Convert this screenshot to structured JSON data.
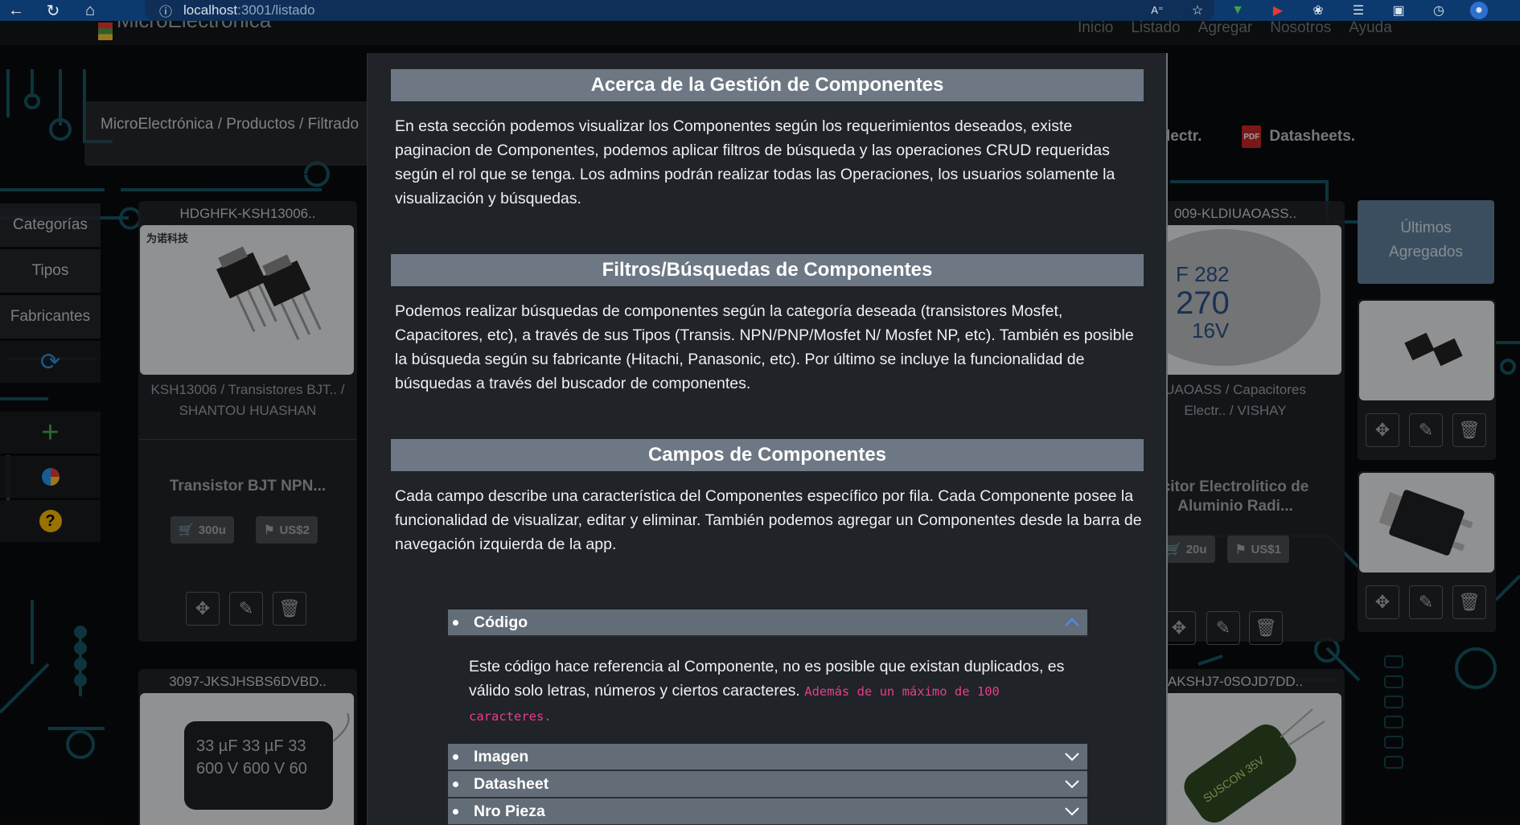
{
  "browser": {
    "info_icon": "info-icon",
    "url_host": "localhost",
    "url_path": ":3001/listado"
  },
  "app": {
    "brand": "MicroElectronica",
    "nav": [
      "Inicio",
      "Listado",
      "Agregar",
      "Nosotros",
      "Ayuda"
    ],
    "breadcrumb": "MicroElectrónica / Productos / Filtrado",
    "sidebar": {
      "items": [
        "Categorías",
        "Tipos",
        "Fabricantes"
      ]
    },
    "cards": {
      "left_top": {
        "code": "HDGHFK-KSH13006..",
        "brand_logo_text": "为诺科技",
        "category_line1": "KSH13006 / Transistores BJT.. /",
        "category_line2": "SHANTOU HUASHAN",
        "title": "Transistor BJT NPN...",
        "stock": "300u",
        "price": "US$2"
      },
      "left_bottom": {
        "code": "3097-JKSJHSBS6DVBD.."
      },
      "mid_top": {
        "code": "009-KLDIUAOASS..",
        "category_line1": "UAOASS / Capacitores",
        "category_line2": "Electr.. / VISHAY",
        "title_line1": "citor Electrolitico de",
        "title_line2": "Aluminio Radi...",
        "stock": "20u",
        "price": "US$1"
      },
      "mid_bottom": {
        "code": "AKSHJ7-0SOJD7DD.."
      }
    },
    "right_header": {
      "electr": "lectr.",
      "datasheets": "Datasheets."
    },
    "latest": {
      "title_line1": "Últimos",
      "title_line2": "Agregados"
    }
  },
  "modal": {
    "sections": [
      {
        "title": "Acerca de la Gestión de Componentes",
        "text": "En esta sección podemos visualizar los Componentes según los requerimientos deseados, existe paginacion de Componentes, podemos aplicar filtros de búsqueda y las operaciones CRUD requeridas según el rol que se tenga. Los admins podrán realizar todas las Operaciones, los usuarios solamente la visualización y búsquedas."
      },
      {
        "title": "Filtros/Búsquedas de Componentes",
        "text": "Podemos realizar búsquedas de componentes según la categoría deseada (transistores Mosfet, Capacitores, etc), a través de sus Tipos (Transis. NPN/PNP/Mosfet N/ Mosfet NP, etc). También es posible la búsqueda según su fabricante (Hitachi, Panasonic, etc). Por último se incluye la funcionalidad de búsquedas a través del buscador de componentes."
      },
      {
        "title": "Campos de Componentes",
        "text": "Cada campo describe una característica del Componentes específico por fila. Cada Componente posee la funcionalidad de visualizar, editar y eliminar. También podemos agregar un Componentes desde la barra de navegación izquierda de la app."
      }
    ],
    "accordion": {
      "open": {
        "label": "Código",
        "body": "Este código hace referencia al Componente, no es posible que existan duplicados, es válido solo letras, números y ciertos caracteres.",
        "highlight": "Además de un máximo de 100 caracteres."
      },
      "collapsed": [
        "Imagen",
        "Datasheet",
        "Nro Pieza"
      ]
    }
  },
  "colors": {
    "browser_bar": "#0d3a6e",
    "section_header": "#6d7884",
    "accordion_header": "#636d77",
    "highlight": "#e83e8c",
    "latest_box": "#5f7f99"
  }
}
